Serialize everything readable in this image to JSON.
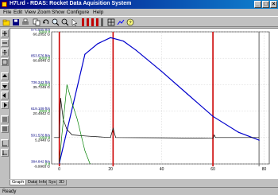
{
  "window": {
    "title": "H7I.rd - RDAS: Rocket Data Aquisition System",
    "icon": "app-icon"
  },
  "menu": [
    "File",
    "Edit",
    "View",
    "Zoom",
    "Show",
    "Configure",
    "Help"
  ],
  "toolbar": {
    "buttons": [
      "open-icon",
      "save-icon",
      "print-icon",
      "copy-icon",
      "undo-icon",
      "zoom-icon",
      "search-icon",
      "pointer-icon"
    ]
  },
  "chart_data": {
    "type": "line",
    "y_axes": [
      {
        "color": "#000080",
        "ticks": [
          "970.909 ft/s",
          "853.576 ft/s",
          "736.242 ft/s",
          "619.109 ft/s",
          "501.576 ft/s",
          "384.842 ft/s"
        ]
      },
      {
        "color": "#000000",
        "ticks": [
          "66.2052 G",
          "60.9646 G",
          "35.7245 G",
          "20.4842 G",
          "5.2440 G",
          "-9.9965 G"
        ]
      },
      {
        "color": "#008000",
        "ticks": [
          "5000 ft",
          "4000 ft",
          "3000 ft",
          "2000 ft",
          "1000 ft",
          "0 ft"
        ]
      }
    ],
    "x_ticks": [
      "0",
      "20",
      "40",
      "60",
      "80"
    ],
    "event_markers": [
      0,
      21,
      60
    ],
    "end_marker": 78,
    "series": [
      {
        "color": "#0000cc",
        "points": [
          [
            0,
            30
          ],
          [
            10,
            4150
          ],
          [
            15,
            4550
          ],
          [
            20,
            4780
          ],
          [
            25,
            4650
          ],
          [
            30,
            4300
          ],
          [
            40,
            3500
          ],
          [
            50,
            2650
          ],
          [
            60,
            1800
          ],
          [
            70,
            1200
          ],
          [
            78,
            900
          ]
        ]
      },
      {
        "color": "#000000",
        "points": [
          [
            -2,
            1000
          ],
          [
            0,
            1000
          ],
          [
            0.5,
            2500
          ],
          [
            1.5,
            1700
          ],
          [
            3,
            1300
          ],
          [
            5,
            1100
          ],
          [
            10,
            1060
          ],
          [
            20,
            1000
          ],
          [
            21,
            1350
          ],
          [
            22,
            1000
          ],
          [
            40,
            990
          ],
          [
            60,
            970
          ],
          [
            60.5,
            1100
          ],
          [
            61,
            1000
          ],
          [
            78,
            1000
          ]
        ]
      },
      {
        "color": "#008000",
        "points": [
          [
            0,
            30
          ],
          [
            1,
            1100
          ],
          [
            3,
            3000
          ],
          [
            5,
            2300
          ],
          [
            7,
            1700
          ],
          [
            10,
            500
          ],
          [
            12,
            0
          ]
        ]
      }
    ],
    "grid": true,
    "title": "",
    "xlabel": "",
    "ylabel": ""
  },
  "tabs": [
    "Graph",
    "Data",
    "Info",
    "Sys",
    "3D"
  ],
  "status": "Ready"
}
